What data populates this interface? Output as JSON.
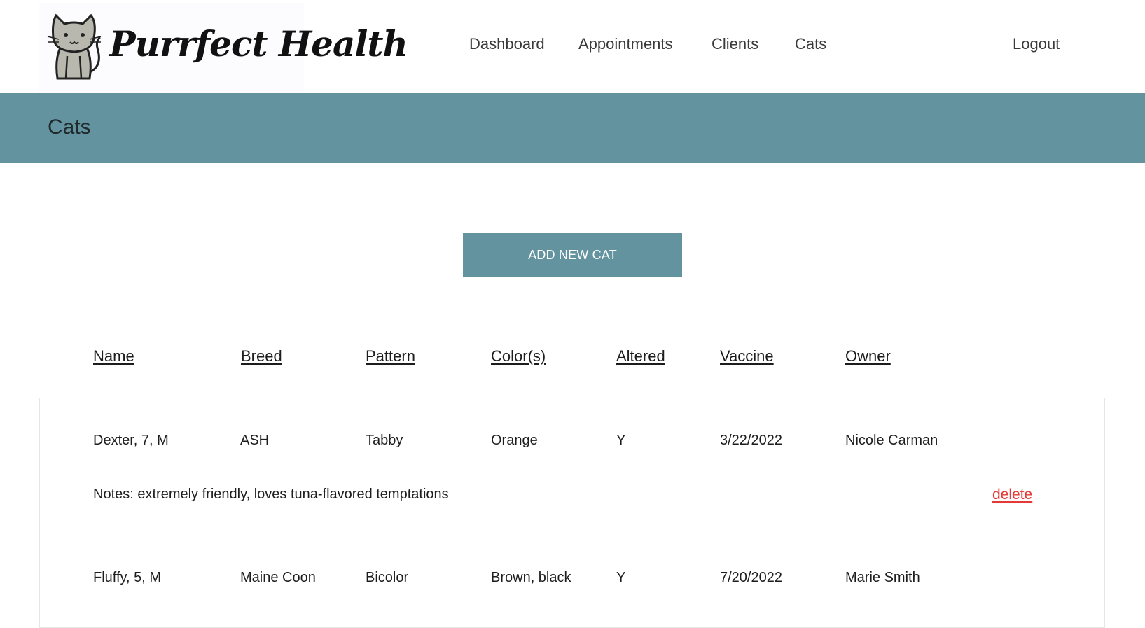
{
  "brand": {
    "name": "Purrfect Health"
  },
  "nav": {
    "items": [
      {
        "label": "Dashboard"
      },
      {
        "label": "Appointments"
      },
      {
        "label": "Clients"
      },
      {
        "label": "Cats"
      }
    ],
    "logout": "Logout"
  },
  "page": {
    "title": "Cats"
  },
  "actions": {
    "add_label": "ADD NEW CAT"
  },
  "table": {
    "columns": [
      "Name",
      "Breed",
      "Pattern",
      "Color(s)",
      "Altered",
      "Vaccine",
      "Owner"
    ],
    "rows": [
      {
        "name": "Dexter, 7, M",
        "breed": "ASH",
        "pattern": "Tabby",
        "colors": "Orange",
        "altered": "Y",
        "vaccine": "3/22/2022",
        "owner": "Nicole Carman",
        "notes": "Notes: extremely friendly, loves tuna-flavored temptations",
        "delete_label": "delete"
      },
      {
        "name": "Fluffy, 5, M",
        "breed": "Maine Coon",
        "pattern": "Bicolor",
        "colors": "Brown, black",
        "altered": "Y",
        "vaccine": "7/20/2022",
        "owner": "Marie Smith"
      }
    ]
  },
  "colors": {
    "accent": "#62939f",
    "delete": "#e53935",
    "text": "#1d1d1d"
  }
}
